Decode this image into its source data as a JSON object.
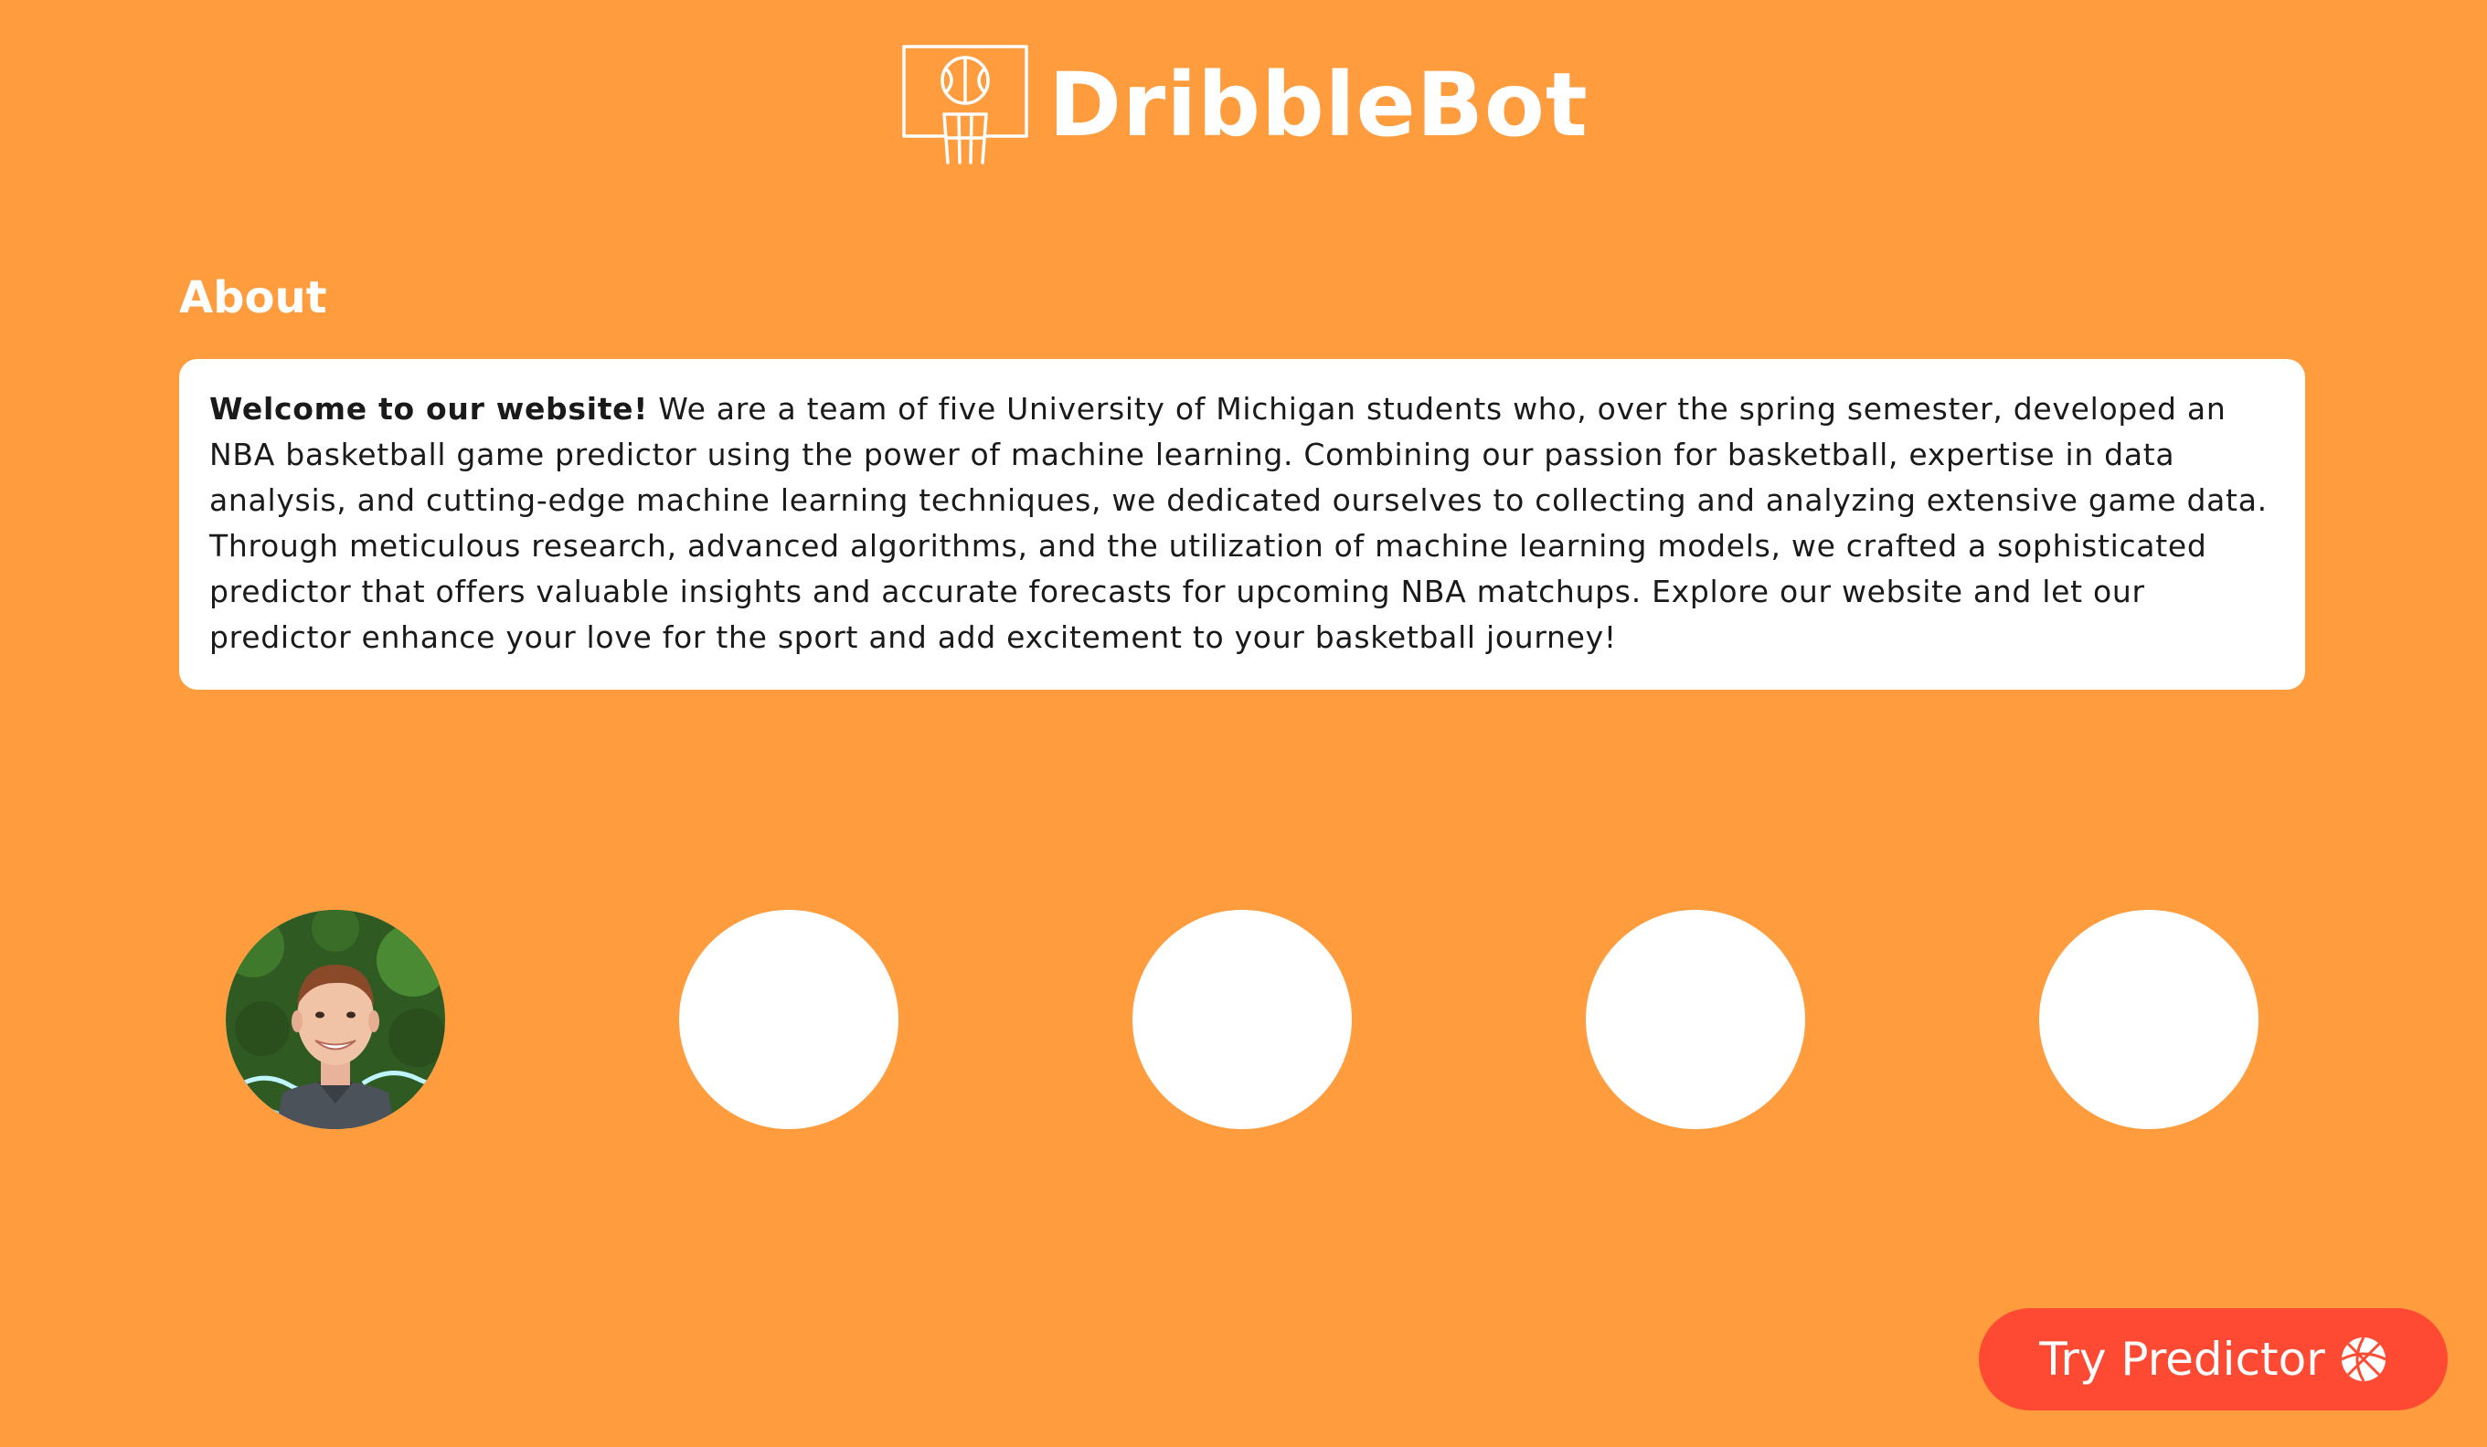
{
  "brand": {
    "name": "DribbleBot",
    "logo_icon": "basketball-hoop-icon"
  },
  "about": {
    "heading": "About",
    "intro_bold": "Welcome to our website!",
    "body": " We are a team of five University of Michigan students who, over the spring semester, developed an NBA basketball game predictor using the power of machine learning. Combining our passion for basketball, expertise in data analysis, and cutting-edge machine learning techniques, we dedicated ourselves to collecting and analyzing extensive game data. Through meticulous research, advanced algorithms, and the utilization of machine learning models, we crafted a sophisticated predictor that offers valuable insights and accurate forecasts for upcoming NBA matchups. Explore our website and let our predictor enhance your love for the sport and add excitement to your basketball journey!"
  },
  "team": {
    "members": [
      {
        "photo": "headshot"
      },
      {
        "photo": "empty"
      },
      {
        "photo": "empty"
      },
      {
        "photo": "empty"
      },
      {
        "photo": "empty"
      }
    ]
  },
  "cta": {
    "label": "Try Predictor",
    "icon": "basketball-icon"
  },
  "colors": {
    "background": "#FF9C3E",
    "card": "#FFFFFF",
    "button": "#FF4A33",
    "text_on_orange": "#FFFFFF"
  }
}
